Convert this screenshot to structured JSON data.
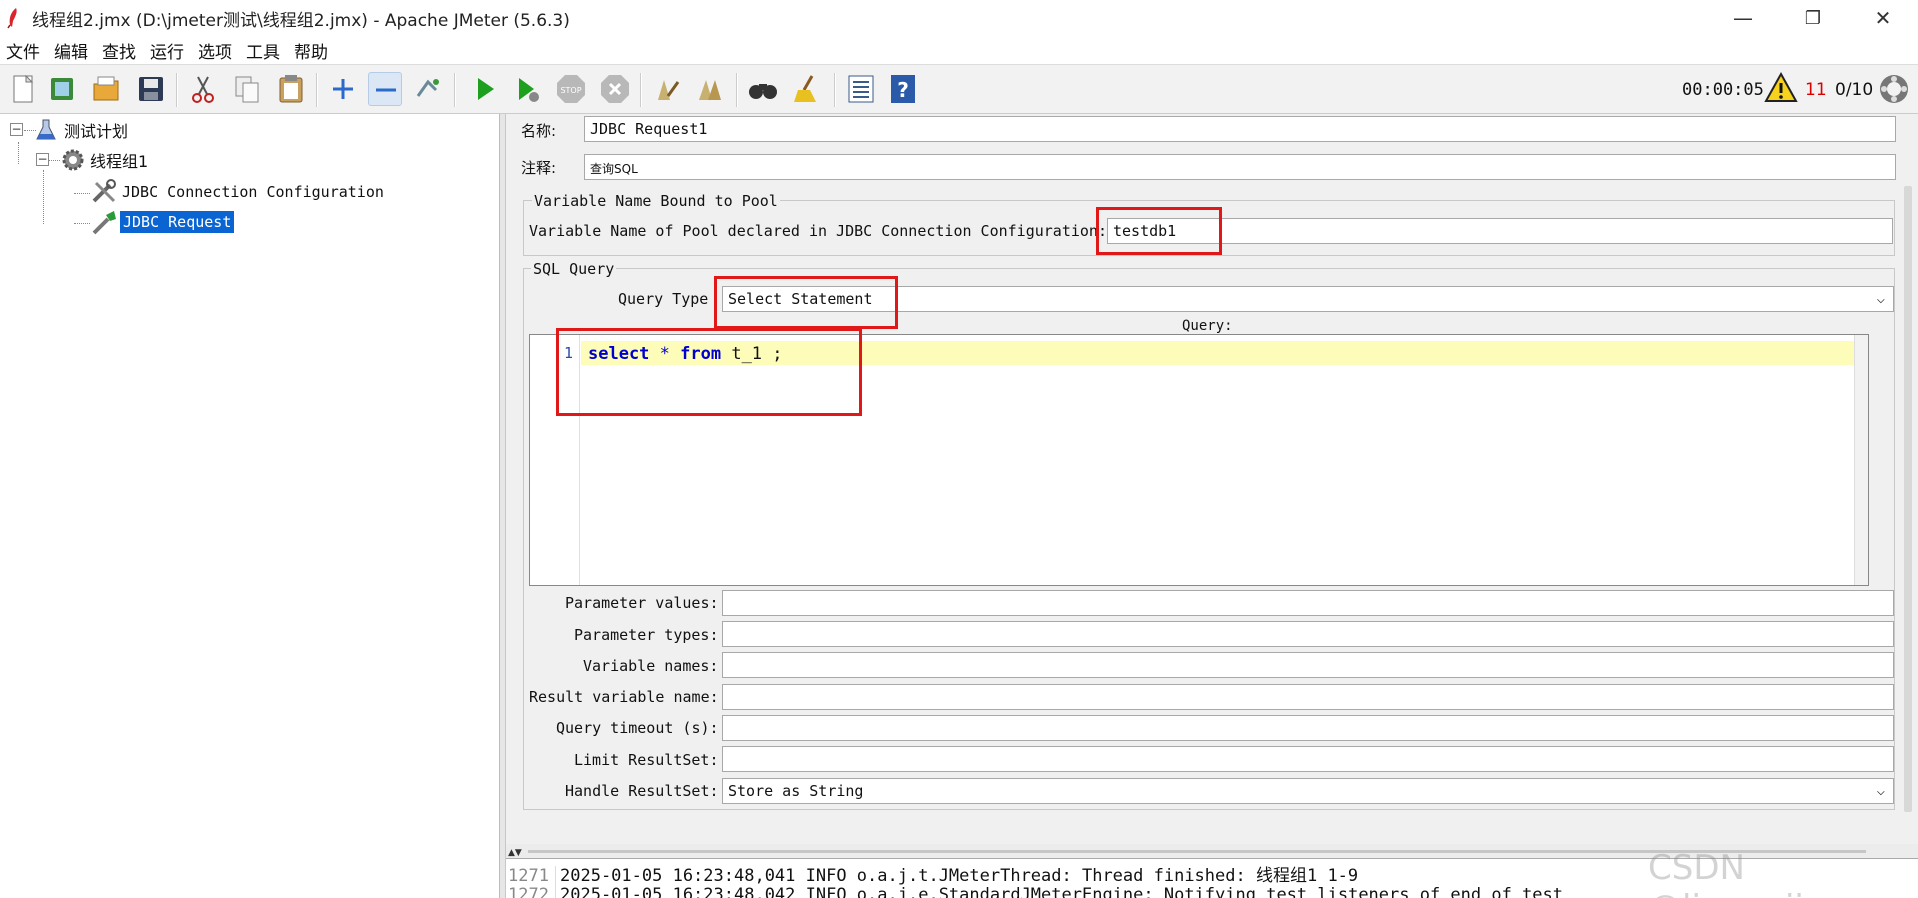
{
  "window": {
    "title": "线程组2.jmx (D:\\jmeter测试\\线程组2.jmx) - Apache JMeter (5.6.3)",
    "minimize": "—",
    "maximize": "❐",
    "close": "✕"
  },
  "menu": [
    "文件",
    "编辑",
    "查找",
    "运行",
    "选项",
    "工具",
    "帮助"
  ],
  "status": {
    "timer": "00:00:05",
    "warnings": "11",
    "threads": "0/10"
  },
  "tree": {
    "plan": "测试计划",
    "thread_group": "线程组1",
    "jdbc_config": "JDBC Connection Configuration",
    "jdbc_request": "JDBC Request"
  },
  "form": {
    "name_label": "名称:",
    "name_value": "JDBC Request1",
    "comment_label": "注释:",
    "comment_value": "查询SQL",
    "pool_group_title": "Variable Name Bound to Pool",
    "pool_label": "Variable Name of Pool declared in JDBC Connection Configuration:",
    "pool_value": "testdb1",
    "sql_group_title": "SQL Query",
    "query_type_label": "Query Type",
    "query_type_value": "Select Statement",
    "query_label": "Query:",
    "line_number": "1",
    "code_select": "select",
    "code_star": " * ",
    "code_from": "from",
    "code_rest": " t_1 ;",
    "param_values_label": "Parameter values:",
    "param_types_label": "Parameter types:",
    "var_names_label": "Variable names:",
    "result_var_label": "Result variable name:",
    "timeout_label": "Query timeout (s):",
    "limit_label": "Limit ResultSet:",
    "handle_label": "Handle ResultSet:",
    "handle_value": "Store as String"
  },
  "log": [
    {
      "no": "1271",
      "text": "2025-01-05 16:23:48,041 INFO o.a.j.t.JMeterThread: Thread finished: 线程组1 1-9"
    },
    {
      "no": "1272",
      "text": "2025-01-05 16:23:48,042 INFO o.a.j.e.StandardJMeterEngine: Notifying test listeners of end of test"
    }
  ],
  "watermark": "CSDN @liyongjie"
}
